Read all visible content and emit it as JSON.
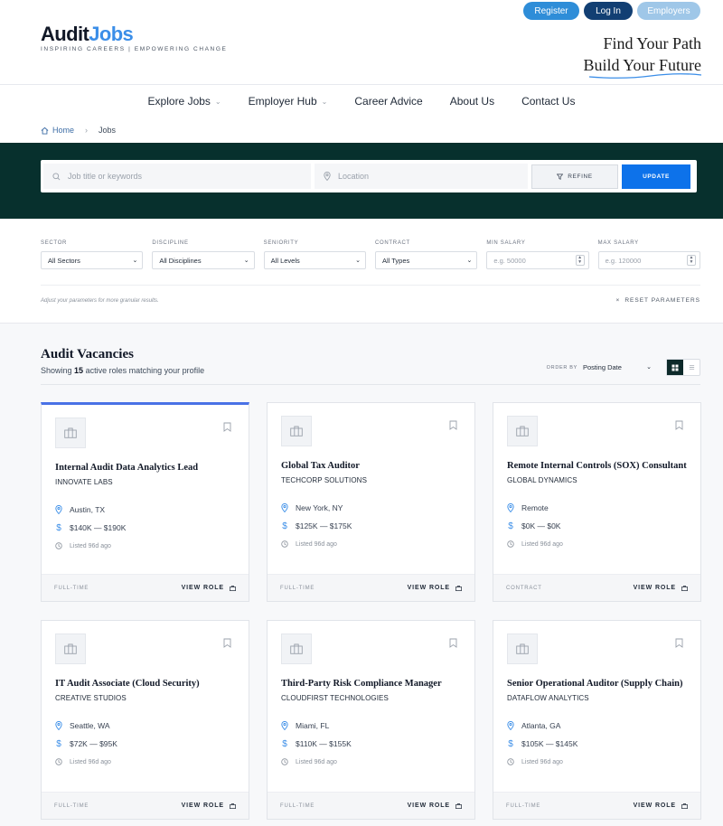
{
  "brand": {
    "logo_main": "Audit",
    "logo_accent": "Jobs",
    "tagline": "INSPIRING CAREERS | EMPOWERING CHANGE",
    "slogan_line1": "Find Your Path",
    "slogan_line2": "Build Your Future"
  },
  "top_buttons": {
    "register": "Register",
    "login": "Log In",
    "employers": "Employers"
  },
  "nav": {
    "explore": "Explore Jobs",
    "employer_hub": "Employer Hub",
    "career_advice": "Career Advice",
    "about": "About Us",
    "contact": "Contact Us"
  },
  "breadcrumb": {
    "home": "Home",
    "current": "Jobs"
  },
  "search": {
    "keyword_placeholder": "Job title or keywords",
    "location_placeholder": "Location",
    "refine": "REFINE",
    "update": "UPDATE"
  },
  "filters": {
    "sector": {
      "label": "SECTOR",
      "value": "All Sectors"
    },
    "discipline": {
      "label": "DISCIPLINE",
      "value": "All Disciplines"
    },
    "seniority": {
      "label": "SENIORITY",
      "value": "All Levels"
    },
    "contract": {
      "label": "CONTRACT",
      "value": "All Types"
    },
    "min_salary": {
      "label": "MIN SALARY",
      "placeholder": "e.g. 50000"
    },
    "max_salary": {
      "label": "MAX SALARY",
      "placeholder": "e.g. 120000"
    },
    "note": "Adjust your parameters for more granular results.",
    "reset": "RESET PARAMETERS"
  },
  "results": {
    "title": "Audit Vacancies",
    "showing_prefix": "Showing",
    "count": "15",
    "showing_suffix": "active roles matching your profile",
    "order_label": "ORDER BY",
    "order_value": "Posting Date"
  },
  "jobs": [
    {
      "title": "Internal Audit Data Analytics Lead",
      "company": "INNOVATE LABS",
      "location": "Austin, TX",
      "salary": "$140K — $190K",
      "listed": "Listed 96d ago",
      "type": "FULL-TIME",
      "cta": "VIEW ROLE"
    },
    {
      "title": "Global Tax Auditor",
      "company": "TECHCORP SOLUTIONS",
      "location": "New York, NY",
      "salary": "$125K — $175K",
      "listed": "Listed 96d ago",
      "type": "FULL-TIME",
      "cta": "VIEW ROLE"
    },
    {
      "title": "Remote Internal Controls (SOX) Consultant",
      "company": "GLOBAL DYNAMICS",
      "location": "Remote",
      "salary": "$0K — $0K",
      "listed": "Listed 96d ago",
      "type": "CONTRACT",
      "cta": "VIEW ROLE"
    },
    {
      "title": "IT Audit Associate (Cloud Security)",
      "company": "CREATIVE STUDIOS",
      "location": "Seattle, WA",
      "salary": "$72K — $95K",
      "listed": "Listed 96d ago",
      "type": "FULL-TIME",
      "cta": "VIEW ROLE"
    },
    {
      "title": "Third-Party Risk Compliance Manager",
      "company": "CLOUDFIRST TECHNOLOGIES",
      "location": "Miami, FL",
      "salary": "$110K — $155K",
      "listed": "Listed 96d ago",
      "type": "FULL-TIME",
      "cta": "VIEW ROLE"
    },
    {
      "title": "Senior Operational Auditor (Supply Chain)",
      "company": "DATAFLOW ANALYTICS",
      "location": "Atlanta, GA",
      "salary": "$105K — $145K",
      "listed": "Listed 96d ago",
      "type": "FULL-TIME",
      "cta": "VIEW ROLE"
    }
  ],
  "icons": {
    "search": "search-icon",
    "location": "map-pin-icon",
    "filter": "filter-icon",
    "salary": "dollar-icon",
    "clock": "clock-icon",
    "bookmark": "bookmark-icon",
    "briefcase": "briefcase-icon",
    "home": "home-icon",
    "grid": "grid-view-icon",
    "list": "list-view-icon"
  },
  "colors": {
    "brand_dark": "#07302d",
    "accent_blue": "#0d72ea",
    "logo_blue": "#3b8ee8",
    "card_highlight": "#4a72e6"
  }
}
